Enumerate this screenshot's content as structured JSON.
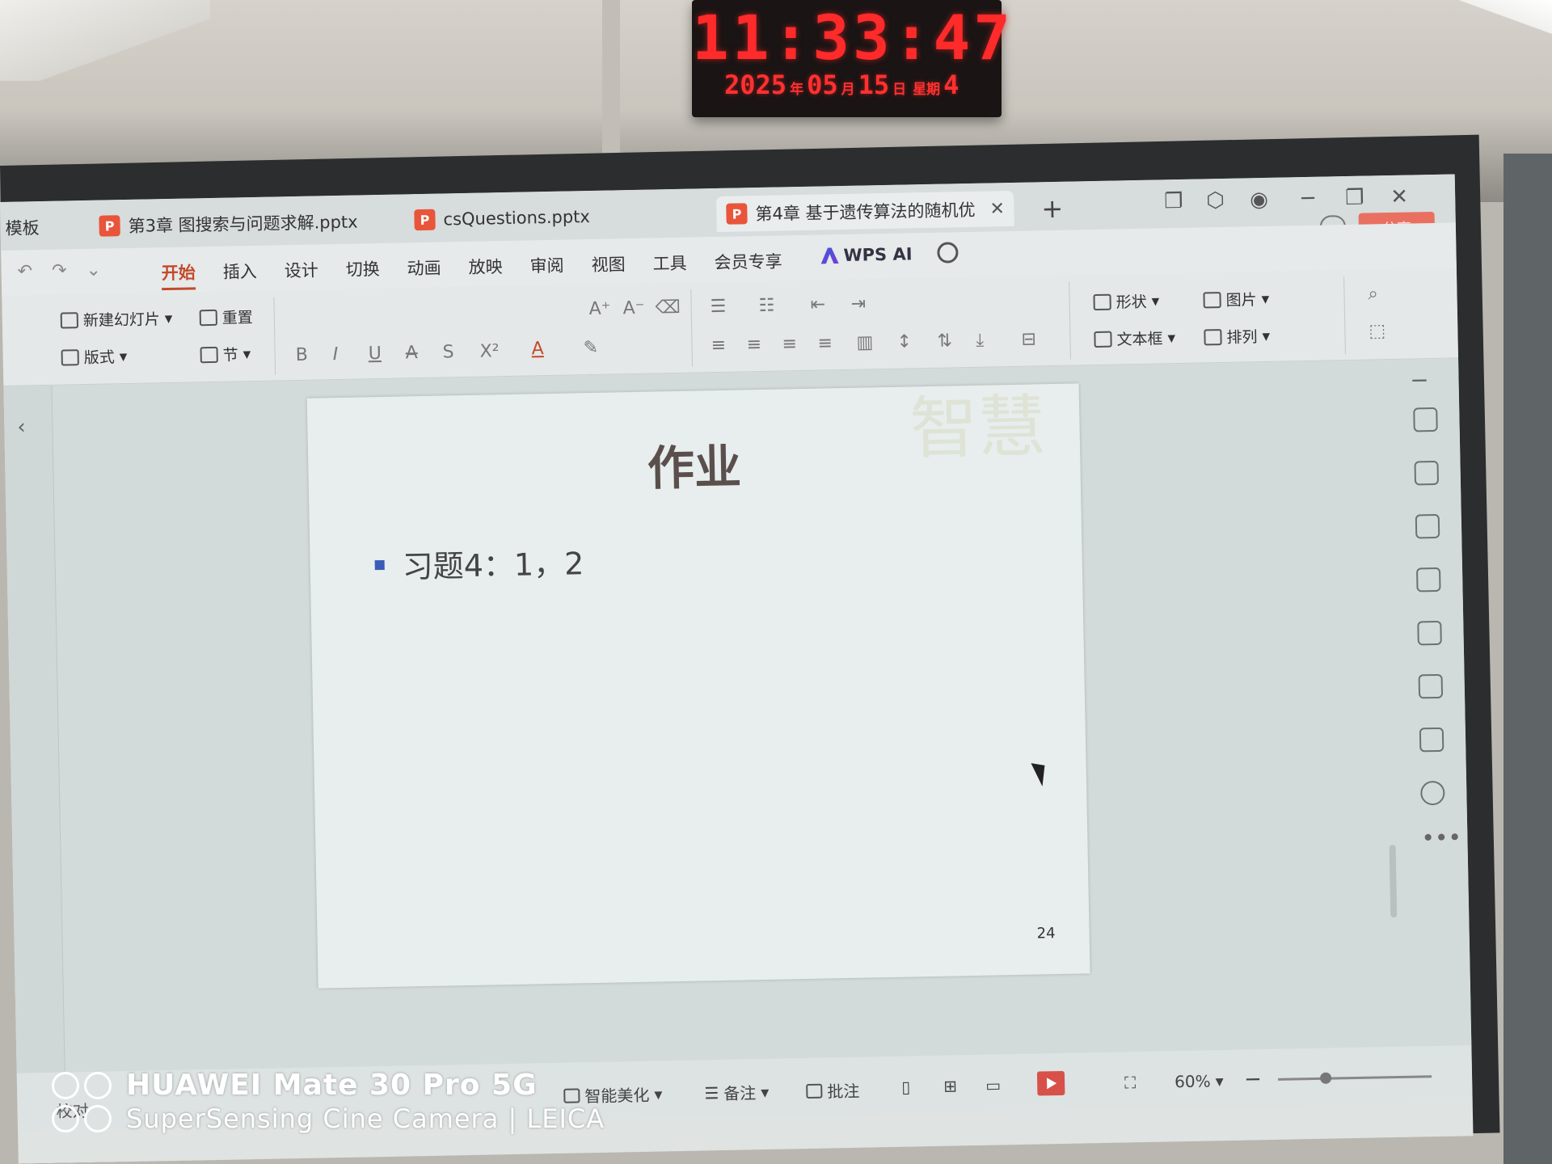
{
  "clock": {
    "time": "11:33:47",
    "year": "2025",
    "year_unit": "年",
    "month": "05",
    "month_unit": "月",
    "day": "15",
    "day_unit": "日",
    "weekday_label": "星期",
    "weekday": "4"
  },
  "tabs": [
    {
      "label": "模板"
    },
    {
      "label": "第3章 图搜索与问题求解.pptx",
      "icon": "P"
    },
    {
      "label": "csQuestions.pptx",
      "icon": "P"
    },
    {
      "label": "第4章 基于遗传算法的随机优",
      "icon": "P"
    }
  ],
  "share_label": "分享",
  "menu": {
    "items": [
      "开始",
      "插入",
      "设计",
      "切换",
      "动画",
      "放映",
      "审阅",
      "视图",
      "工具",
      "会员专享"
    ],
    "active": "开始",
    "ai_label": "WPS AI"
  },
  "ribbon": {
    "new_slide": "新建幻灯片",
    "reset": "重置",
    "layout": "版式",
    "section": "节",
    "shape": "形状",
    "picture": "图片",
    "textbox": "文本框",
    "arrange": "排列",
    "bold": "B",
    "italic": "I",
    "underline": "U",
    "strike": "A",
    "shadow": "S",
    "superscript": "X²",
    "font_color": "A"
  },
  "slide": {
    "title": "作业",
    "bullet": "习题4：1，2",
    "page_number": "24",
    "watermark": "智慧"
  },
  "statusbar": {
    "beautify": "智能美化",
    "notes": "备注",
    "comments": "批注",
    "zoom": "60%",
    "proofread": "校对"
  },
  "camera": {
    "line1": "HUAWEI Mate 30 Pro 5G",
    "line2": "SuperSensing Cine Camera | LEICA"
  },
  "colors": {
    "accent": "#c44a2a",
    "share": "#e97060",
    "ppt_icon": "#e8553a",
    "led": "#ff2a2a"
  }
}
